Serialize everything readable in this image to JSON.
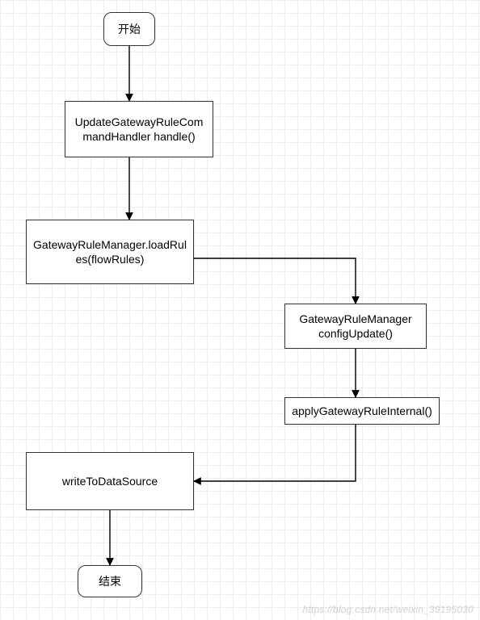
{
  "chart_data": {
    "type": "flowchart",
    "direction": "top-down",
    "nodes": [
      {
        "id": "start",
        "label": "开始",
        "shape": "rounded-rect"
      },
      {
        "id": "n1",
        "label": "UpdateGatewayRuleCommandHandler handle()",
        "shape": "rect"
      },
      {
        "id": "n2",
        "label": "GatewayRuleManager.loadRules(flowRules)",
        "shape": "rect"
      },
      {
        "id": "n3",
        "label": "GatewayRuleManager configUpdate()",
        "shape": "rect"
      },
      {
        "id": "n4",
        "label": "applyGatewayRuleInternal()",
        "shape": "rect"
      },
      {
        "id": "n5",
        "label": "writeToDataSource",
        "shape": "rect"
      },
      {
        "id": "end",
        "label": "结束",
        "shape": "rounded-rect"
      }
    ],
    "edges": [
      {
        "from": "start",
        "to": "n1"
      },
      {
        "from": "n1",
        "to": "n2"
      },
      {
        "from": "n2",
        "to": "n3"
      },
      {
        "from": "n3",
        "to": "n4"
      },
      {
        "from": "n4",
        "to": "n5"
      },
      {
        "from": "n5",
        "to": "end"
      }
    ]
  },
  "nodes": {
    "start": "开始",
    "n1": "UpdateGatewayRuleCommandHandler handle()",
    "n2": "GatewayRuleManager.loadRules(flowRules)",
    "n3": "GatewayRuleManager configUpdate()",
    "n4": "applyGatewayRuleInternal()",
    "n5": "writeToDataSource",
    "end": "结束"
  },
  "watermark": "https://blog.csdn.net/weixin_39195030"
}
